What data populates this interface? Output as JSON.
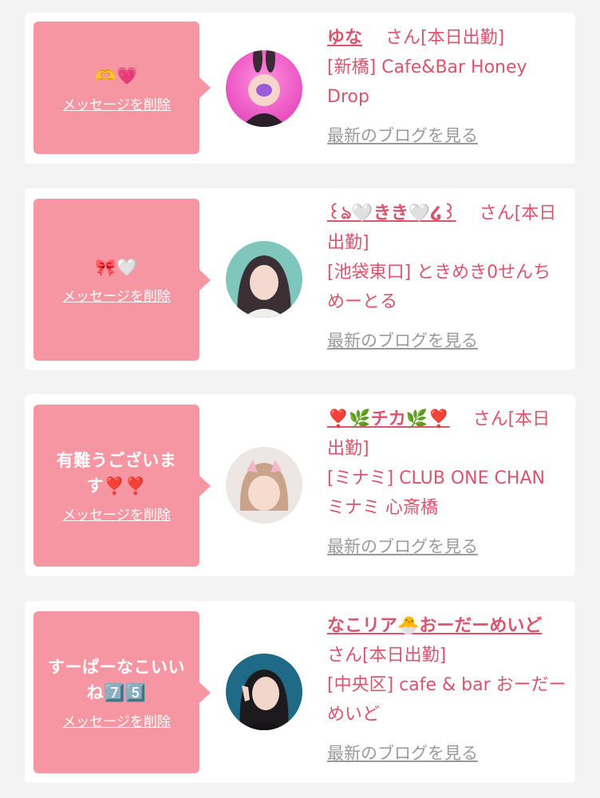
{
  "cards": [
    {
      "message": "🫶💗",
      "delete_label": "メッセージを削除",
      "name": "ゆな",
      "suffix": "さん[本日出勤]",
      "shop": "[新橋] Cafe&Bar Honey Drop",
      "blog_label": "最新のブログを見る"
    },
    {
      "message": "🎀🤍",
      "delete_label": "メッセージを削除",
      "name": "꒰ঌ🤍きき🤍໒꒱",
      "suffix": "さん[本日出勤]",
      "shop": "[池袋東口] ときめき0せんちめーとる",
      "blog_label": "最新のブログを見る"
    },
    {
      "message": "有難うございます❣️❣️",
      "delete_label": "メッセージを削除",
      "name": "❣️🌿チカ🌿❣️",
      "suffix": "さん[本日出勤]",
      "shop": "[ミナミ] CLUB ONE CHAN ミナミ 心斎橋",
      "blog_label": "最新のブログを見る"
    },
    {
      "message": "すーぱーなこいいね7️⃣5️⃣",
      "delete_label": "メッセージを削除",
      "name": "なこリア🐣おーだーめいど",
      "suffix": "さん[本日出勤]",
      "shop": "[中央区] cafe & bar おーだーめいど",
      "blog_label": "最新のブログを見る"
    }
  ],
  "colors": {
    "bubble": "#f796a3",
    "accent": "#d9546d",
    "link_gray": "#9a9a9a",
    "page_bg": "#f3f3f3"
  }
}
